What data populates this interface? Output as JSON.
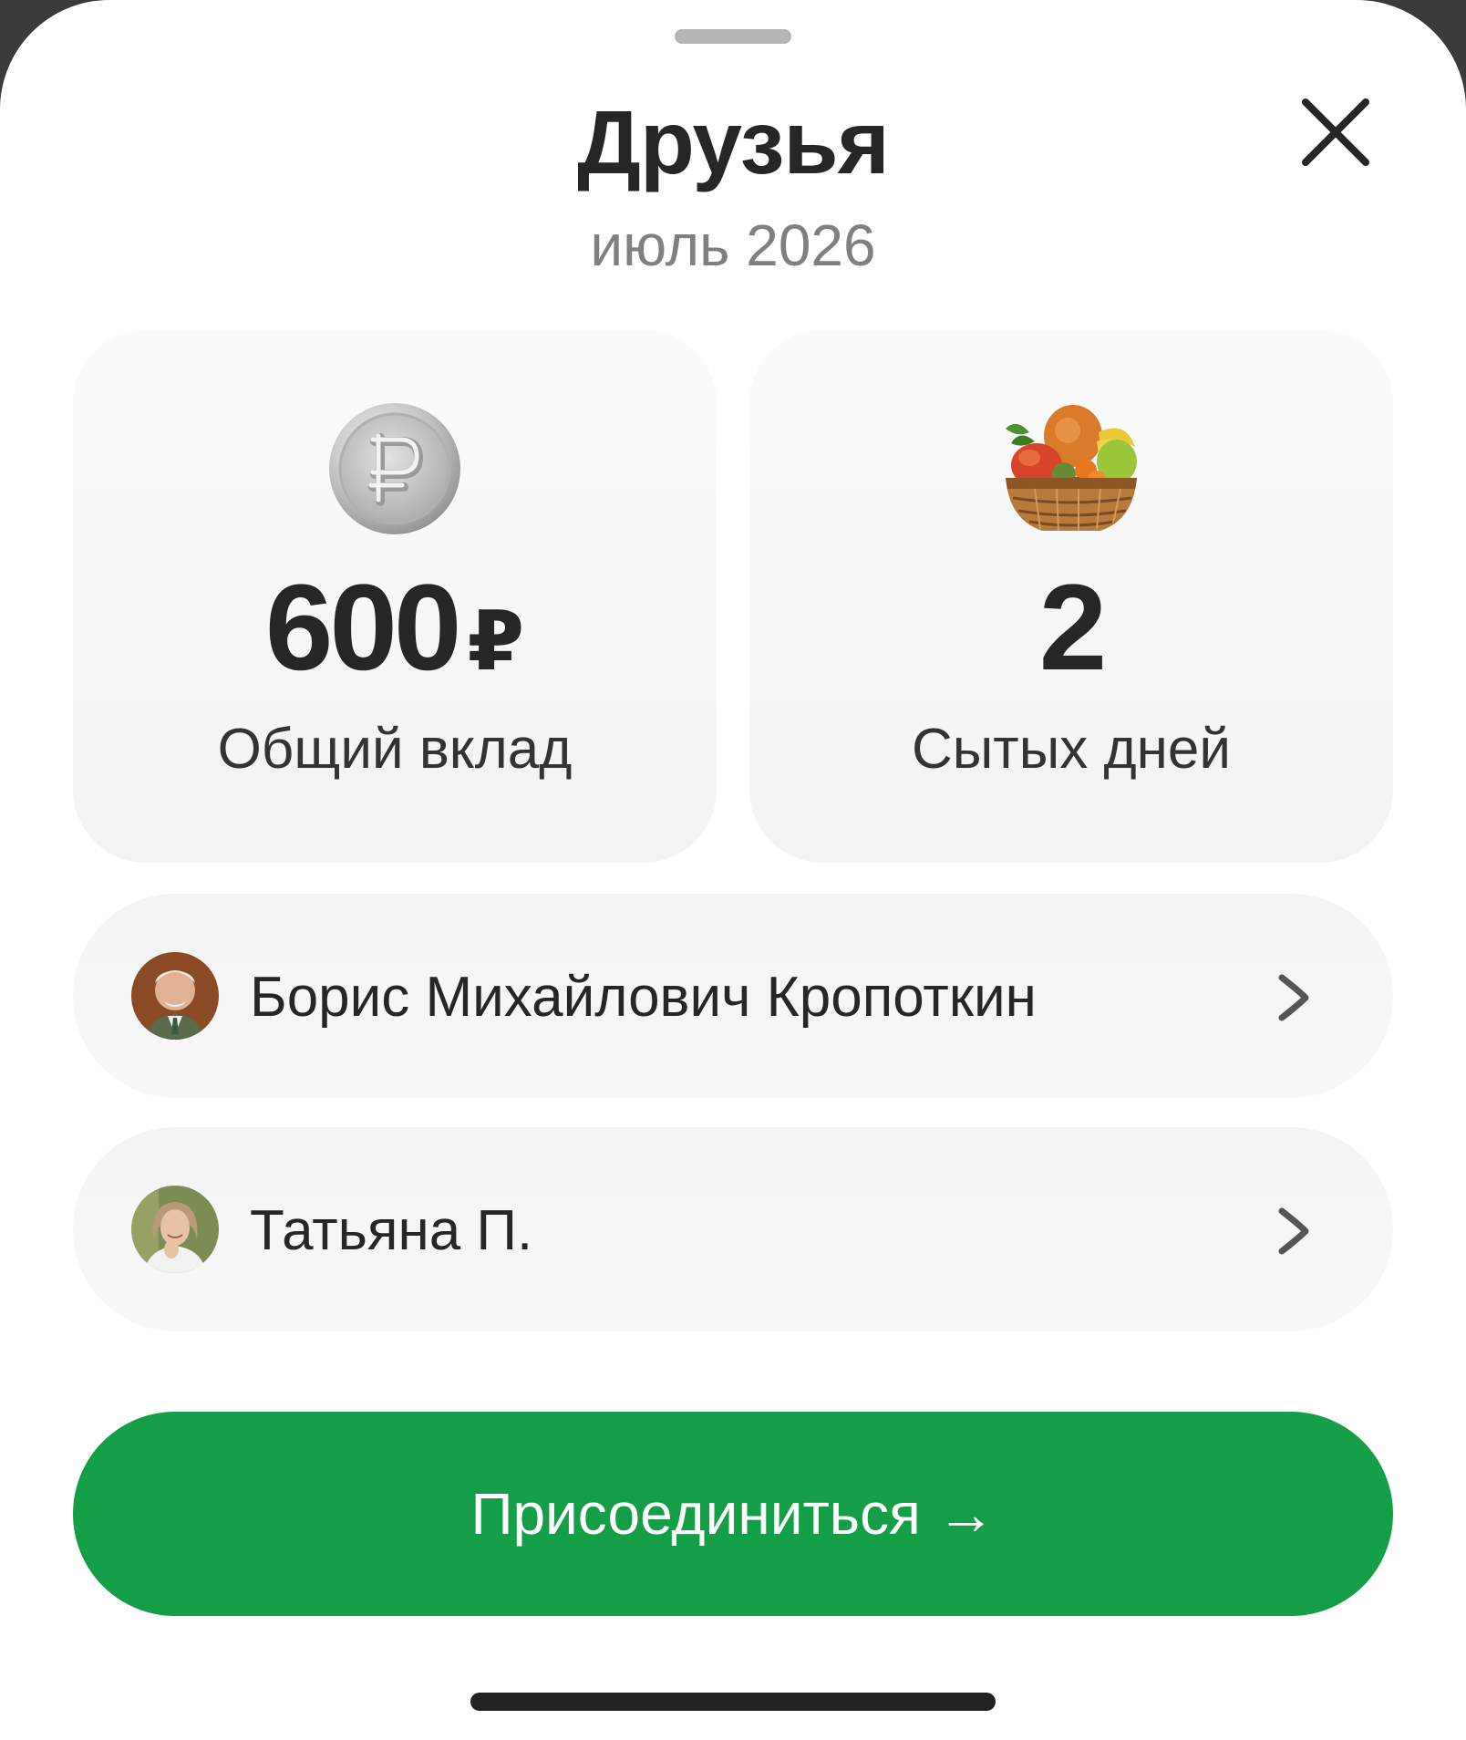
{
  "header": {
    "title": "Друзья",
    "subtitle": "июль 2026"
  },
  "stats": [
    {
      "icon": "silver-ruble-coin-icon",
      "value": "600",
      "unit": "₽",
      "label": "Общий вклад"
    },
    {
      "icon": "fruit-basket-icon",
      "value": "2",
      "unit": "",
      "label": "Сытых дней"
    }
  ],
  "friends": [
    {
      "name": "Борис Михайлович Кропоткин",
      "avatar_bg": "#8a4a25"
    },
    {
      "name": "Татьяна П.",
      "avatar_bg": "#7d8b55"
    }
  ],
  "cta": {
    "label": "Присоединиться →",
    "color": "#149e47"
  }
}
